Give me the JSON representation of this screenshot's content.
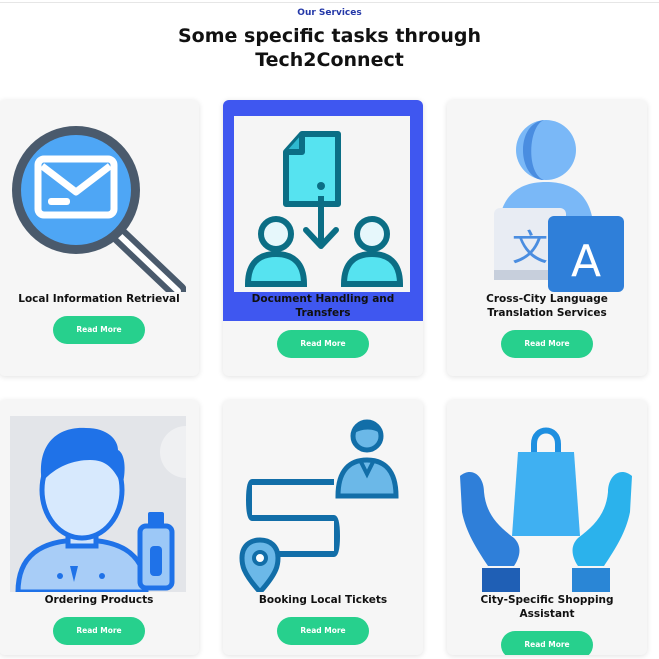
{
  "section": {
    "eyebrow": "Our Services",
    "title": "Some specific tasks through Tech2Connect"
  },
  "cards": [
    {
      "title": "Local Information Retrieval",
      "button": "Read More",
      "icon": "magnifier-mail-icon"
    },
    {
      "title": "Document Handling and Transfers",
      "button": "Read More",
      "icon": "document-transfer-icon"
    },
    {
      "title": "Cross-City Language Translation Services",
      "button": "Read More",
      "icon": "translation-person-icon"
    },
    {
      "title": "Ordering Products",
      "button": "Read More",
      "icon": "person-order-icon"
    },
    {
      "title": "Booking Local Tickets",
      "button": "Read More",
      "icon": "route-ticket-icon"
    },
    {
      "title": "City-Specific Shopping Assistant",
      "button": "Read More",
      "icon": "hands-shopping-bag-icon"
    }
  ],
  "colors": {
    "accent": "#27d08d",
    "heading_blue": "#2438a8",
    "highlight": "#3f57f0"
  }
}
